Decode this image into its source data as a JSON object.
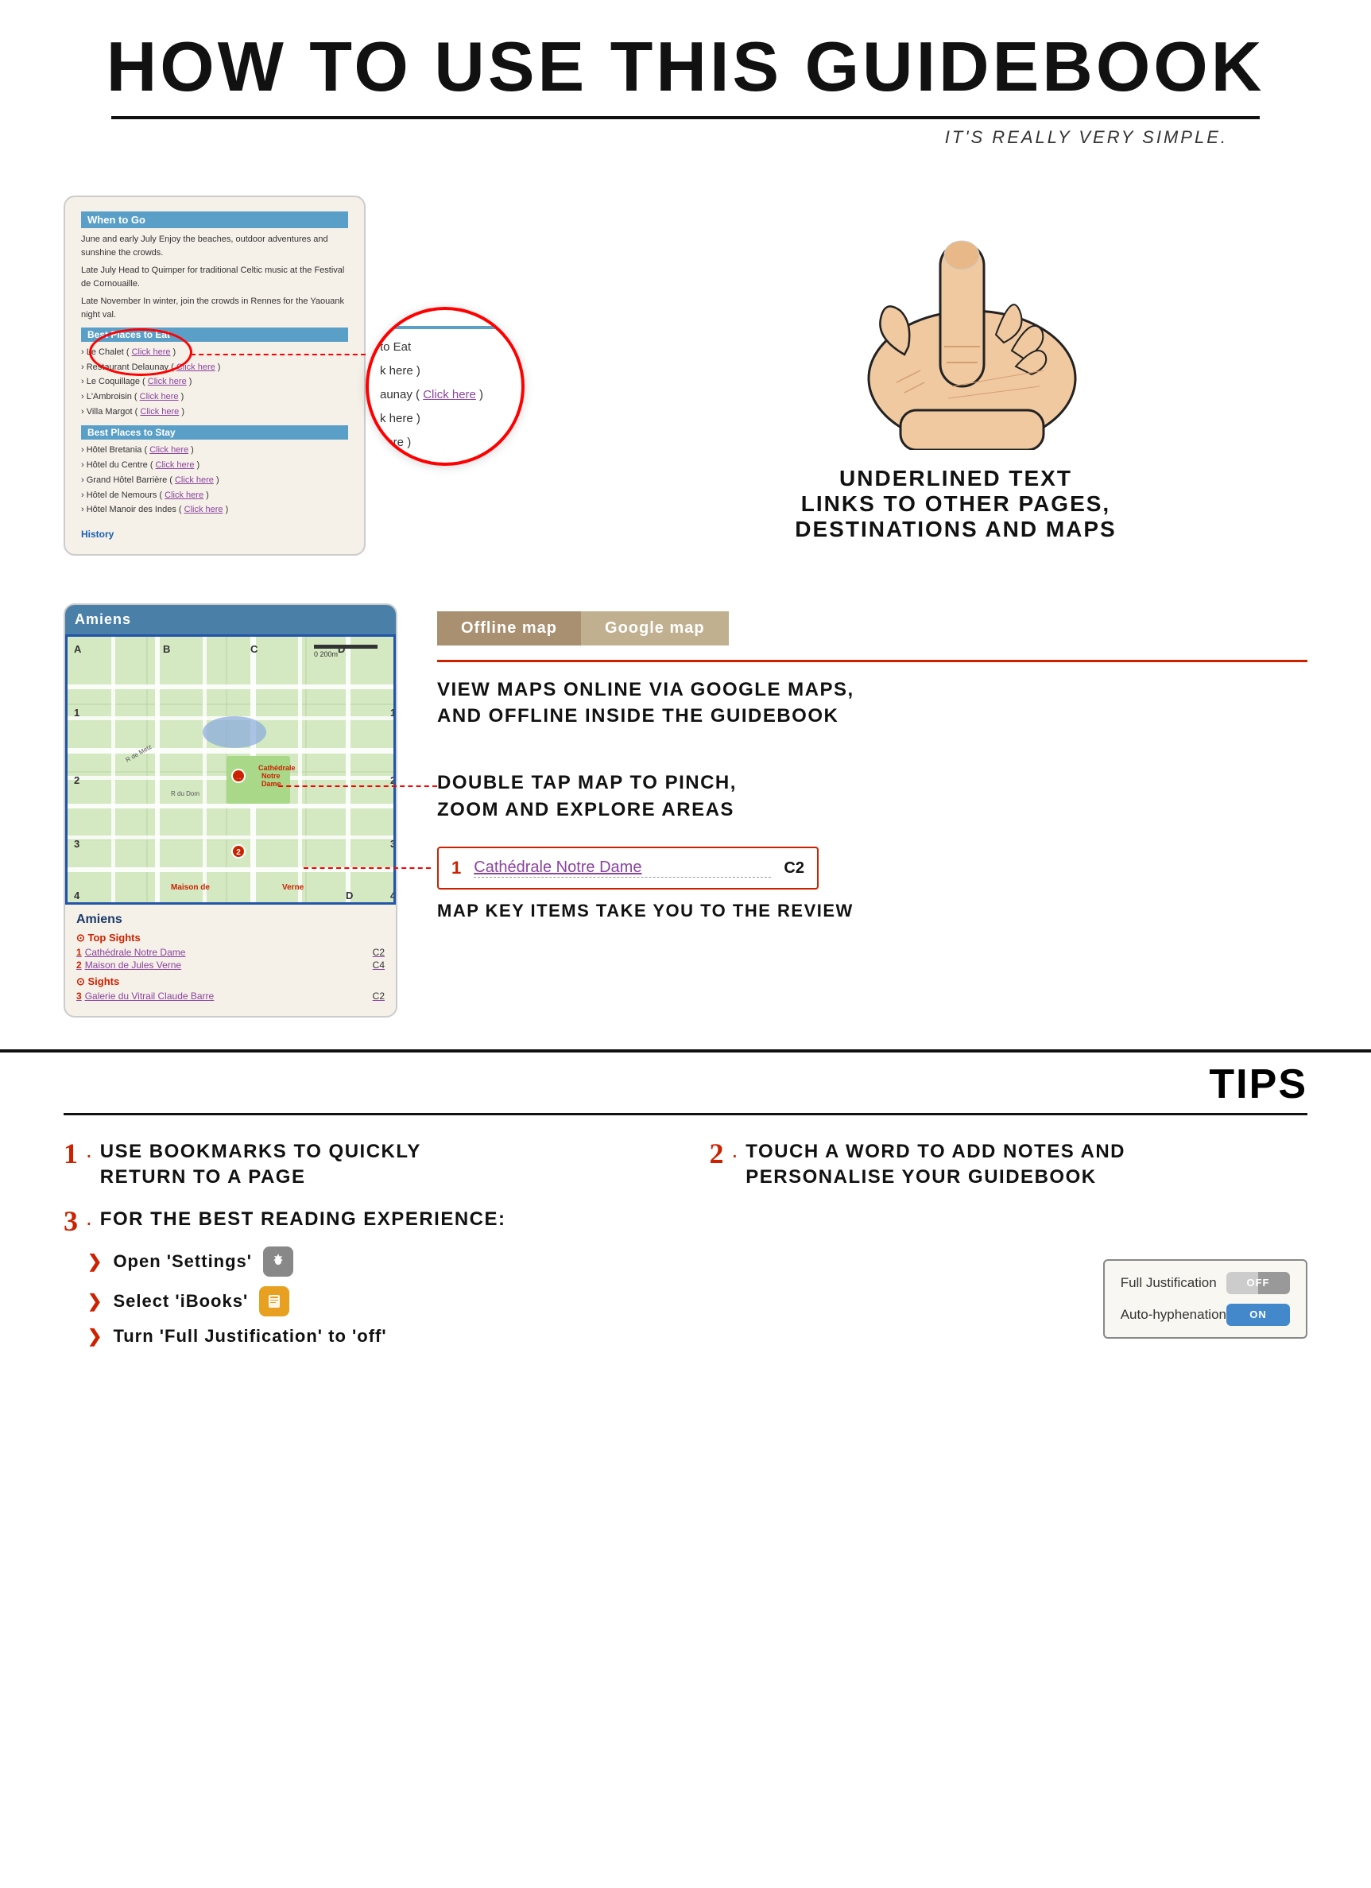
{
  "header": {
    "title": "HOW TO USE THIS GUIDEBOOK",
    "subtitle": "IT'S REALLY VERY SIMPLE."
  },
  "section1": {
    "guidebook": {
      "when_to_go_title": "When to Go",
      "when_to_go_text1": "June and early July Enjoy the beaches, outdoor adventures and sunshine the crowds.",
      "when_to_go_text2": "Late July Head to Quimper for traditional Celtic music at the Festival de Cornouaille.",
      "when_to_go_text3": "Late November In winter, join the crowds in Rennes for the Yaouank night val.",
      "best_eat_title": "Best Places to Eat",
      "places_eat": [
        "› Le Chalet ( Click here )",
        "› Restaurant Delaunay ( Click here )",
        "› Le Coquillage ( Click here )",
        "› L'Ambroisin ( Click here )",
        "› Villa Margot ( Click here )"
      ],
      "best_stay_title": "Best Places to Stay",
      "places_stay": [
        "› Hôtel Bretania ( Click here )",
        "› Hôtel du Centre ( Click here )",
        "› Grand Hôtel Barrière ( Click here )",
        "› Hôtel de Nemours ( Click here )",
        "› Hôtel Manoir des Indes ( Click here )"
      ],
      "history_link": "History"
    },
    "zoom_items": [
      "to Eat",
      "k here )",
      "aunay ( Click here )",
      "k here )",
      "here )"
    ],
    "label": {
      "line1": "UNDERLINED TEXT",
      "line2": "LINKS TO OTHER PAGES,",
      "line3": "DESTINATIONS AND MAPS"
    }
  },
  "section2": {
    "map_phone": {
      "city": "Amiens",
      "city2": "Amiens",
      "top_sights_label": "⊙ Top Sights",
      "sights": [
        {
          "num": "1",
          "name": "Cathédrale Notre Dame",
          "coord": "C2"
        },
        {
          "num": "2",
          "name": "Maison de Jules Verne",
          "coord": "C4"
        }
      ],
      "sights_label": "⊙ Sights",
      "other_sights": [
        {
          "num": "3",
          "name": "Galerie du Vitrail Claude Barre",
          "coord": "C2"
        }
      ]
    },
    "buttons": {
      "offline": "Offline map",
      "google": "Google map"
    },
    "map_description": "VIEW MAPS ONLINE VIA GOOGLE MAPS,\nAND OFFLINE INSIDE THE GUIDEBOOK",
    "double_tap_text": "DOUBLE TAP MAP TO PINCH,\nZOOM AND EXPLORE AREAS",
    "key_box": {
      "num": "1",
      "name": "Cathédrale Notre Dame",
      "coord": "C2"
    },
    "key_description": "MAP KEY ITEMS TAKE YOU TO THE REVIEW"
  },
  "tips": {
    "title": "TIPS",
    "items": [
      {
        "num": "1",
        "text": "USE BOOKMARKS TO QUICKLY\nRETURN TO A PAGE"
      },
      {
        "num": "2",
        "text": "TOUCH A WORD TO ADD NOTES AND\nPERSONALISE YOUR GUIDEBOOK"
      },
      {
        "num": "3",
        "text": "FOR THE BEST READING EXPERIENCE:"
      }
    ],
    "tip3_sub": [
      {
        "text": "Open 'Settings'",
        "icon": "settings"
      },
      {
        "text": "Select 'iBooks'",
        "icon": "ibooks"
      },
      {
        "text": "Turn 'Full Justification' to 'off'",
        "icon": "none"
      }
    ],
    "toggles": [
      {
        "label": "Full Justification",
        "state": "OFF",
        "active": false
      },
      {
        "label": "Auto-hyphenation",
        "state": "ON",
        "active": true
      }
    ]
  }
}
